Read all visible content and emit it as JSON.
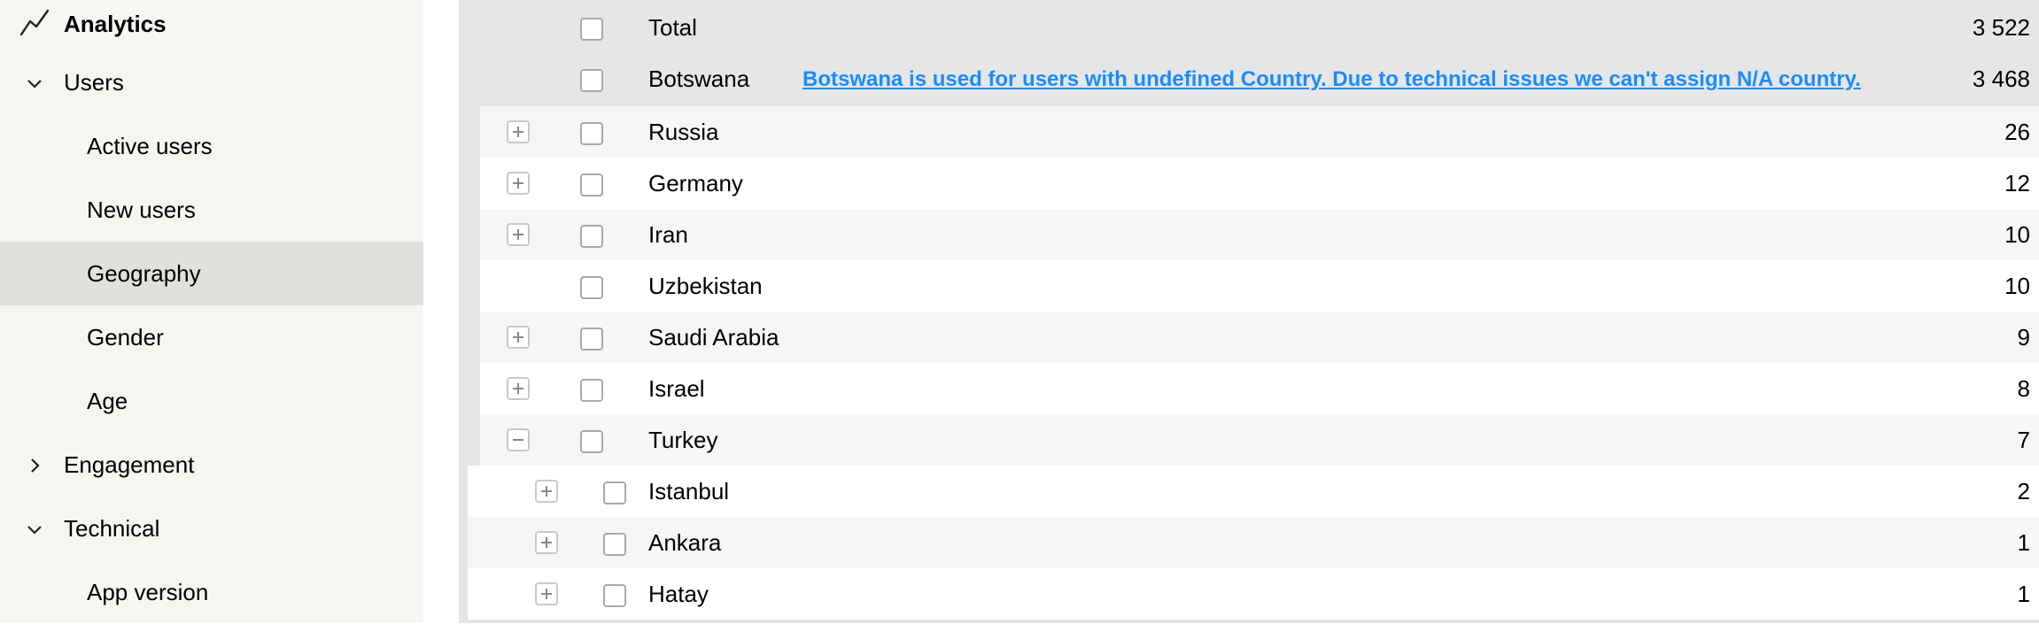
{
  "sidebar": {
    "title": "Analytics",
    "title_icon": "analytics-line-icon",
    "items": [
      {
        "label": "Users",
        "kind": "group",
        "expanded": true
      },
      {
        "label": "Active users",
        "kind": "sub"
      },
      {
        "label": "New users",
        "kind": "sub"
      },
      {
        "label": "Geography",
        "kind": "sub",
        "active": true
      },
      {
        "label": "Gender",
        "kind": "sub"
      },
      {
        "label": "Age",
        "kind": "sub"
      },
      {
        "label": "Engagement",
        "kind": "group",
        "expanded": false
      },
      {
        "label": "Technical",
        "kind": "group",
        "expanded": true
      },
      {
        "label": "App version",
        "kind": "sub"
      }
    ]
  },
  "table": {
    "colors": {
      "total_bg": "#e6e6e6",
      "alt_bg": "#f6f6f4",
      "note": "#1a8cff"
    },
    "rows": [
      {
        "name": "Total",
        "value": "3 522",
        "level": 0,
        "expand": "none"
      },
      {
        "name": "Botswana",
        "value": "3 468",
        "level": 0,
        "expand": "none",
        "note": "Botswana is used for users with undefined Country. Due to technical issues we can't assign N/A country."
      },
      {
        "name": "Russia",
        "value": "26",
        "level": 1,
        "expand": "plus"
      },
      {
        "name": "Germany",
        "value": "12",
        "level": 1,
        "expand": "plus"
      },
      {
        "name": "Iran",
        "value": "10",
        "level": 1,
        "expand": "plus"
      },
      {
        "name": "Uzbekistan",
        "value": "10",
        "level": 1,
        "expand": "none"
      },
      {
        "name": "Saudi Arabia",
        "value": "9",
        "level": 1,
        "expand": "plus"
      },
      {
        "name": "Israel",
        "value": "8",
        "level": 1,
        "expand": "plus"
      },
      {
        "name": "Turkey",
        "value": "7",
        "level": 1,
        "expand": "minus"
      },
      {
        "name": "Istanbul",
        "value": "2",
        "level": 2,
        "expand": "plus"
      },
      {
        "name": "Ankara",
        "value": "1",
        "level": 2,
        "expand": "plus"
      },
      {
        "name": "Hatay",
        "value": "1",
        "level": 2,
        "expand": "plus"
      }
    ]
  }
}
